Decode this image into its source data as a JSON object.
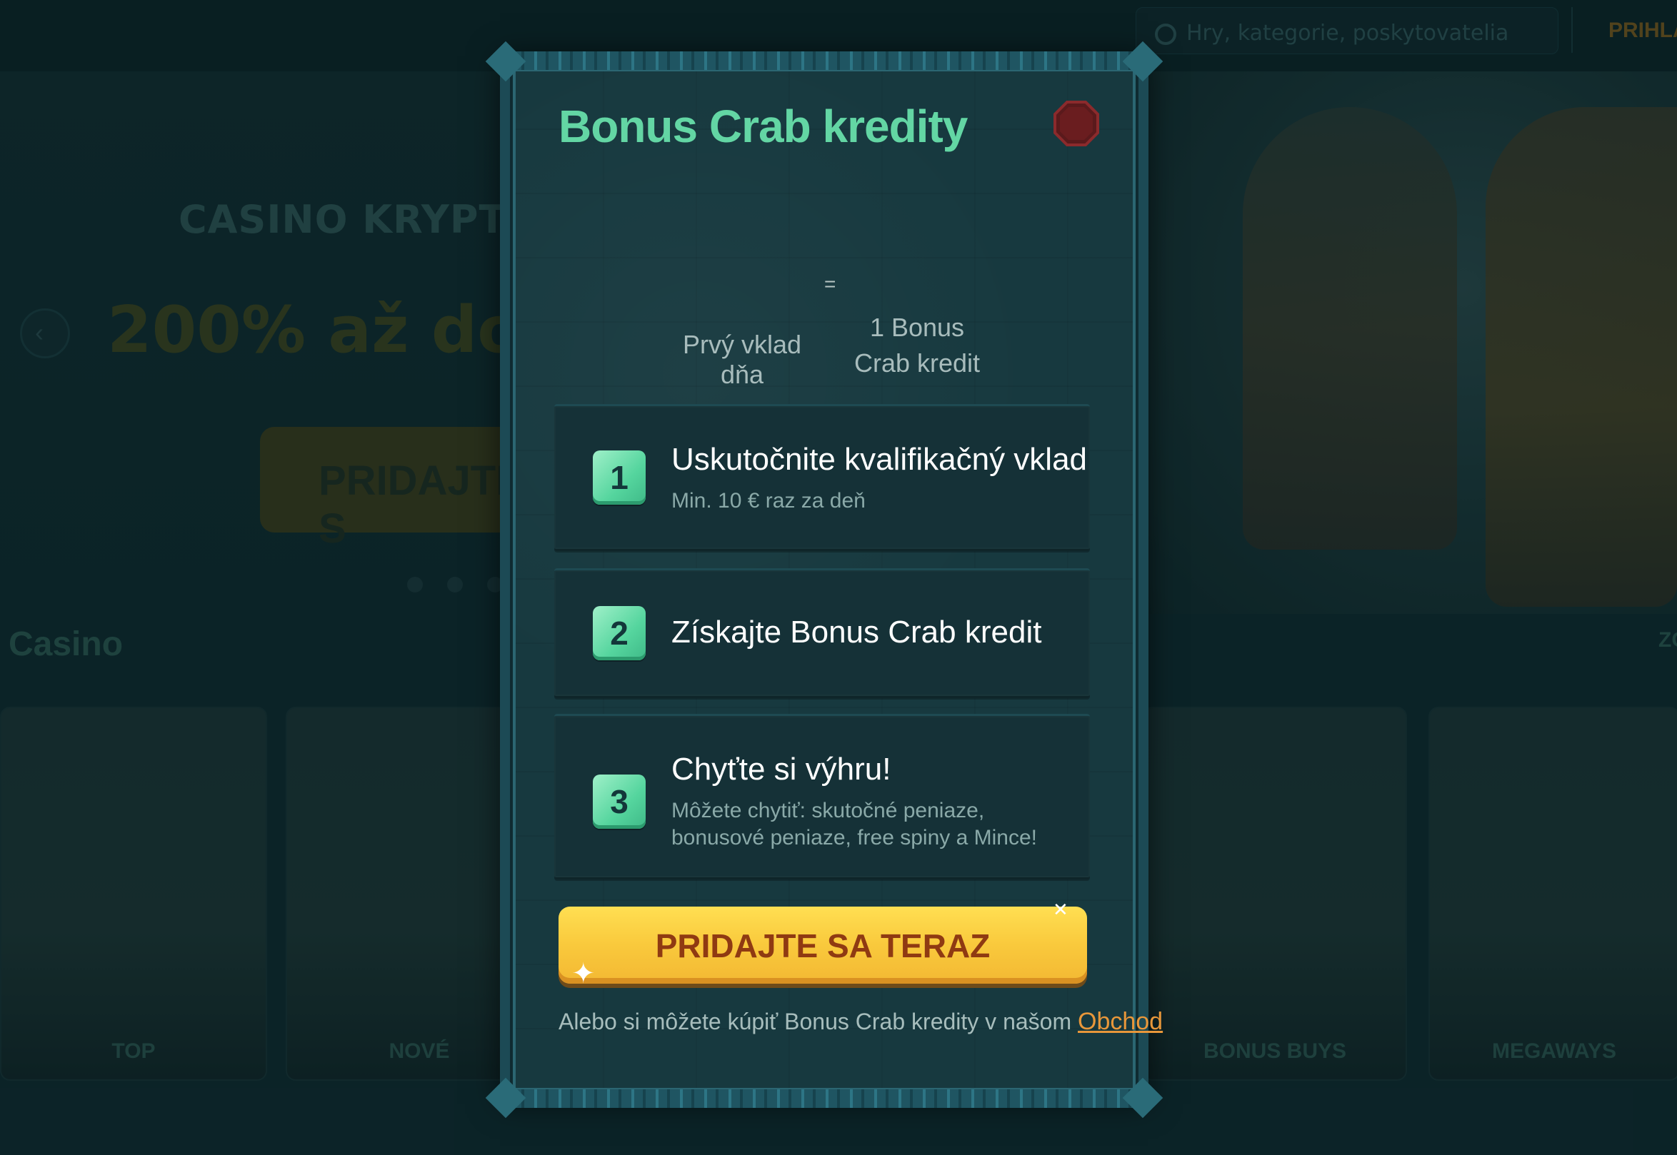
{
  "background": {
    "search_placeholder": "Hry, kategorie, poskytovatelia",
    "login_label": "PRIHLA",
    "hero_title": "CASINO KRYPTO U",
    "hero_offer": "200% až do 3",
    "hero_button": "PRIDAJTE S",
    "section_title": "Casino",
    "right_edge_label": "ZO",
    "category_cards": [
      "TOP",
      "NOVÉ",
      "BONUS BUYS",
      "MEGAWAYS"
    ]
  },
  "modal": {
    "title": "Bonus Crab kredity",
    "equals": "=",
    "deposit_label": "Prvý vklad dňa",
    "credit_label": "1 Bonus Crab kredit",
    "steps": [
      {
        "number": "1",
        "title": "Uskutočnite kvalifikačný vklad",
        "subtitle": "Min. 10 € raz za deň"
      },
      {
        "number": "2",
        "title": "Získajte Bonus Crab kredit",
        "subtitle": ""
      },
      {
        "number": "3",
        "title": "Chyťte si výhru!",
        "subtitle": "Môžete chytiť: skutočné peniaze, bonusové peniaze, free spiny a Mince!"
      }
    ],
    "cta_label": "PRIDAJTE SA TERAZ",
    "footer_text": "Alebo si môžete kúpiť Bonus Crab kredity v našom",
    "shop_link": "Obchod",
    "close_icon": "close-octagon-icon"
  },
  "colors": {
    "accent_green": "#63d6a4",
    "cta_yellow": "#f9c93c",
    "cta_text": "#8f3a12",
    "link_orange": "#e8973a",
    "close_red": "#6a1d1f"
  }
}
